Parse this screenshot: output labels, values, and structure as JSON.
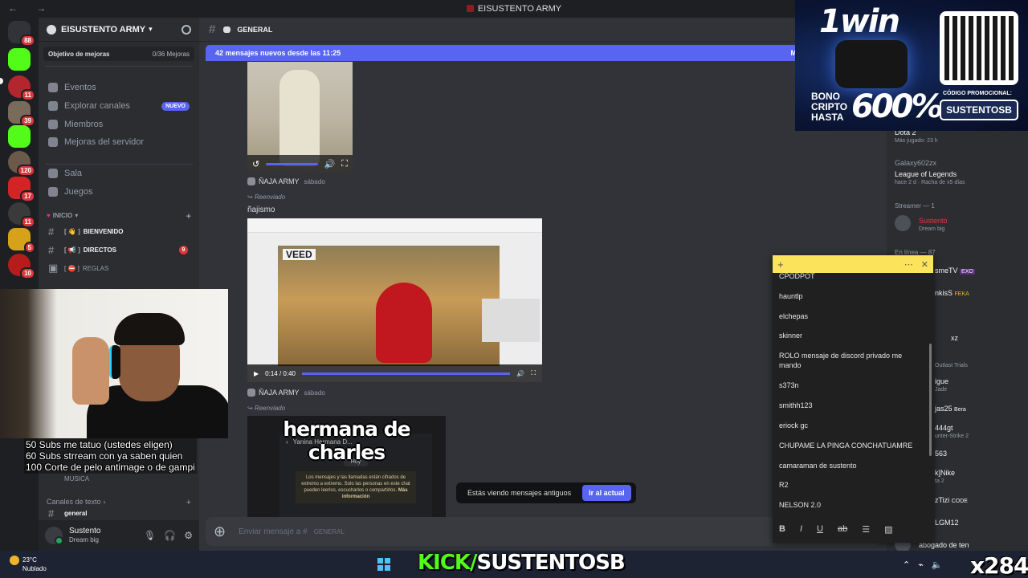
{
  "window": {
    "title": "EISUSTENTO ARMY"
  },
  "rail": {
    "dm_badge": "88",
    "badges": [
      "11",
      "39",
      "120",
      "17",
      "11",
      "5",
      "10"
    ]
  },
  "server": {
    "name": "EISUSTENTO ARMY",
    "boost_label": "Objetivo de mejoras",
    "boost_progress": "0/36 Mejoras",
    "nav": [
      {
        "label": "Eventos"
      },
      {
        "label": "Explorar canales",
        "badge": "NUEVO"
      },
      {
        "label": "Miembros"
      },
      {
        "label": "Mejoras del servidor"
      }
    ],
    "voice": [
      {
        "label": "Sala"
      },
      {
        "label": "Juegos"
      }
    ],
    "category_inicio": "INICIO",
    "channels": [
      {
        "label": "BIENVENIDO"
      },
      {
        "label": "DIRECTOS",
        "mention": "9"
      },
      {
        "label": "REGLAS"
      }
    ],
    "musica": "MUSICA",
    "category_text": "Canales de texto",
    "general_partial": "general"
  },
  "user": {
    "name": "Sustento",
    "status": "Dream big"
  },
  "channel": {
    "name": "GENERAL",
    "new_messages": "42 mensajes nuevos desde las 11:25",
    "new_messages_mark": "M",
    "messages": [
      {
        "author": "ÑAJA ARMY",
        "time": "sábado",
        "forwarded": "Reenviado",
        "text": "ñajismo",
        "video_time": "0:14 / 0:40",
        "video_brand": "VEED"
      },
      {
        "author": "ÑAJA ARMY",
        "time": "sábado",
        "forwarded": "Reenviado",
        "caption": "hermana de charles",
        "chat_contact": "Yanina Hermana D...",
        "chat_today": "Hoy",
        "chat_notice": "Los mensajes y las llamadas están cifrados de extremo a extremo. Solo las personas en este chat pueden leerlos, escucharlos o compartirlos.",
        "chat_more": "Más información"
      }
    ],
    "old_notice": "Estás viendo mensajes antiguos",
    "jump_button": "Ir al actual",
    "composer_placeholder": "Enviar mensaje a #",
    "composer_channel": "GENERAL"
  },
  "members": {
    "items": [
      {
        "name": "Dota 2",
        "sub": "Más jugado: 23 h"
      },
      {
        "name": "Galaxy602zx",
        "sub": ""
      },
      {
        "name": "League of Legends",
        "sub": "hace 2 d · Racha de x5 días"
      }
    ],
    "streamer_header": "Streamer — 1",
    "streamer": {
      "name": "Sustento",
      "status": "Dream big"
    },
    "online_header": "En línea — 87",
    "partial": [
      "smeTV",
      "EXO",
      "nkisS",
      "FEKA",
      "xz",
      "Outlast Trials",
      "igue",
      "Jade",
      "jas25",
      "Bera",
      "444gt",
      "unter-Strike 2",
      "563",
      "k]Nike",
      "ta 2",
      "zTizi",
      "CODE",
      "LGM12",
      "abogado de ten"
    ]
  },
  "overlay": {
    "subs_lines": [
      "50 Subs me tatuo (ustedes eligen)",
      "60 Subs strream con ya saben quien",
      "100 Corte de pelo antimage o de gampi"
    ],
    "promo": {
      "brand": "1win",
      "bono": [
        "BONO",
        "CRIPTO",
        "HASTA"
      ],
      "percent": "600%",
      "code_label": "CÓDIGO PROMOCIONAL:",
      "code": "SUSTENTOSB"
    },
    "kick": {
      "prefix": "KICK/",
      "name": "SUSTENTOSB"
    },
    "counter": "x284"
  },
  "notes": {
    "items": [
      "CPODPOT",
      "hauntlp",
      "elchepas",
      "skinner",
      "ROLO mensaje de discord privado me mando",
      "s373n",
      "smithh123",
      "eriock gc",
      "CHUPAME LA PINGA CONCHATUAMRE",
      "camaraman de sustento",
      "R2",
      "NELSON 2.0"
    ],
    "format": [
      "B",
      "I",
      "U",
      "ab"
    ]
  },
  "taskbar": {
    "temp": "23°C",
    "weather": "Nublado"
  },
  "colors": {
    "blurple": "#5865f2",
    "kick_green": "#53fc18",
    "notes_yellow": "#fbe35b"
  }
}
